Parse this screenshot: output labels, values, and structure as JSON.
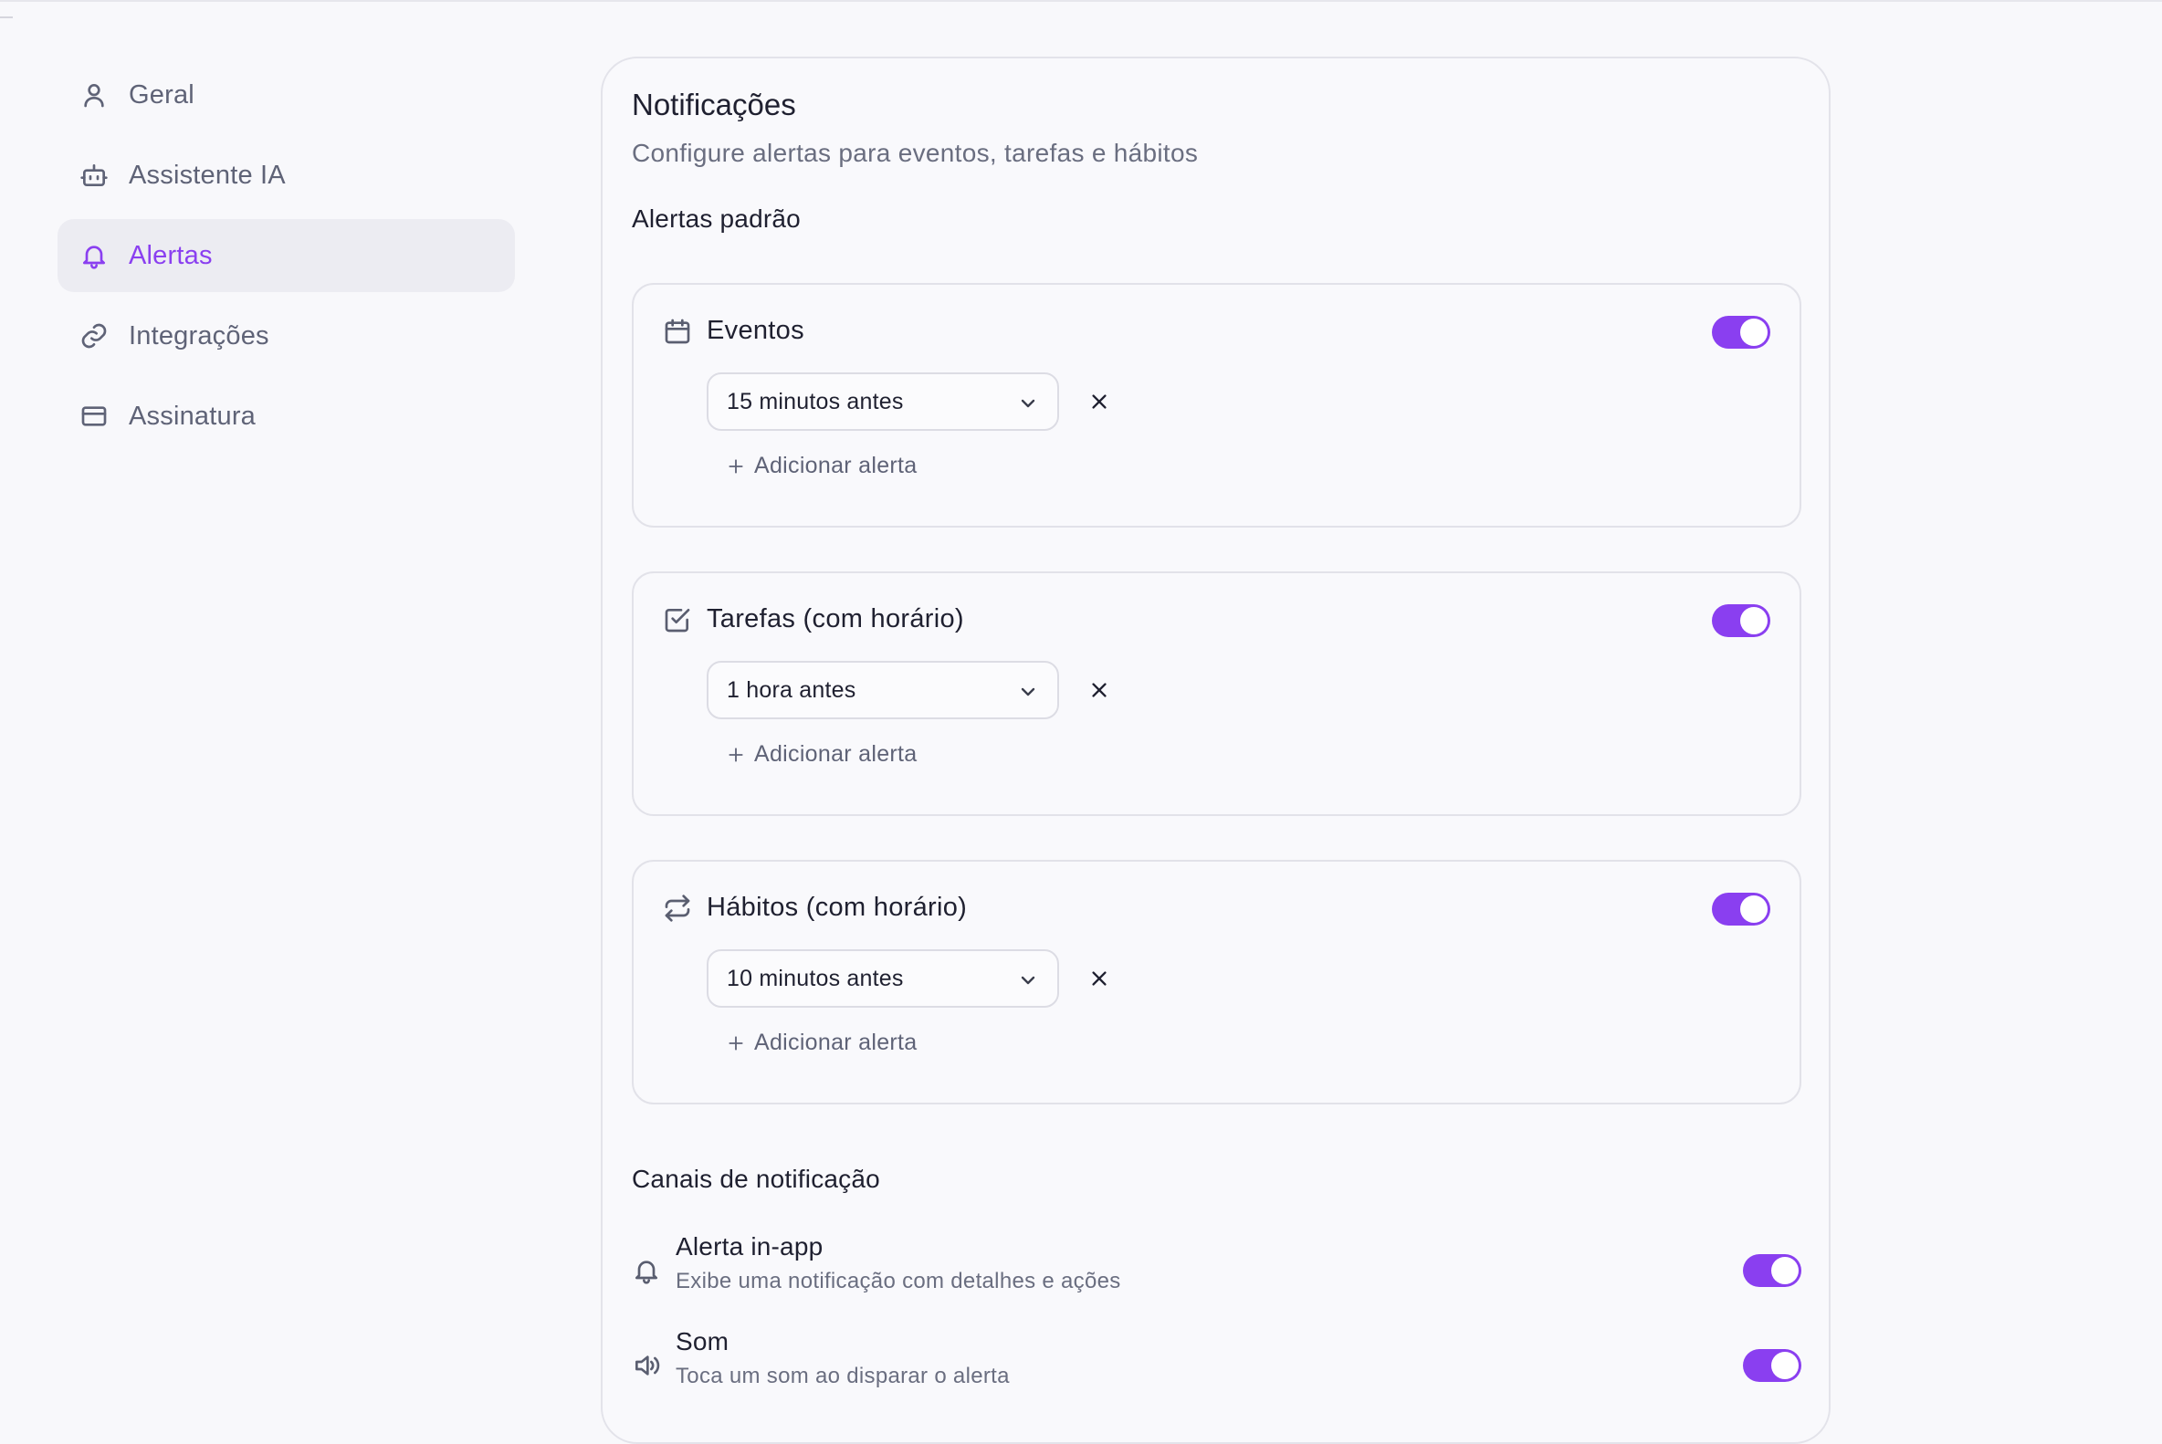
{
  "sidebar": {
    "items": [
      {
        "label": "Geral",
        "icon": "user-icon",
        "active": false
      },
      {
        "label": "Assistente IA",
        "icon": "bot-icon",
        "active": false
      },
      {
        "label": "Alertas",
        "icon": "bell-icon",
        "active": true
      },
      {
        "label": "Integrações",
        "icon": "link-icon",
        "active": false
      },
      {
        "label": "Assinatura",
        "icon": "credit-card-icon",
        "active": false
      }
    ]
  },
  "main": {
    "title": "Notificações",
    "subtitle": "Configure alertas para eventos, tarefas e hábitos",
    "default_alerts": {
      "section_title": "Alertas padrão",
      "add_label": "Adicionar alerta",
      "cards": [
        {
          "title": "Eventos",
          "icon": "calendar-icon",
          "enabled": true,
          "selected": "15 minutos antes"
        },
        {
          "title": "Tarefas (com horário)",
          "icon": "checkbox-icon",
          "enabled": true,
          "selected": "1 hora antes"
        },
        {
          "title": "Hábitos (com horário)",
          "icon": "repeat-icon",
          "enabled": true,
          "selected": "10 minutos antes"
        }
      ]
    },
    "channels": {
      "section_title": "Canais de notificação",
      "items": [
        {
          "title": "Alerta in-app",
          "description": "Exibe uma notificação com detalhes e ações",
          "icon": "bell-icon",
          "enabled": true
        },
        {
          "title": "Som",
          "description": "Toca um som ao disparar o alerta",
          "icon": "speaker-icon",
          "enabled": true
        }
      ]
    }
  },
  "colors": {
    "accent": "#8a3ff0",
    "active_nav_bg": "#ececf2",
    "text_muted": "#5f6377"
  }
}
